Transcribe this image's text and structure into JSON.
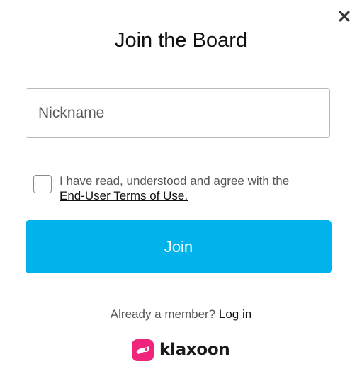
{
  "dialog": {
    "close_icon": "close-icon",
    "title": "Join the Board"
  },
  "form": {
    "nickname_placeholder": "Nickname",
    "nickname_value": "",
    "terms_checked": false,
    "terms_text": "I have read, understood and agree with the",
    "terms_link": "End-User Terms of Use.",
    "join_label": "Join"
  },
  "footer": {
    "member_text": "Already a member?",
    "login_link": "Log in",
    "brand_name": "klaxoon",
    "brand_icon": "klaxoon-logo-icon"
  },
  "colors": {
    "accent": "#00b4eb",
    "brand": "#f0247a"
  }
}
